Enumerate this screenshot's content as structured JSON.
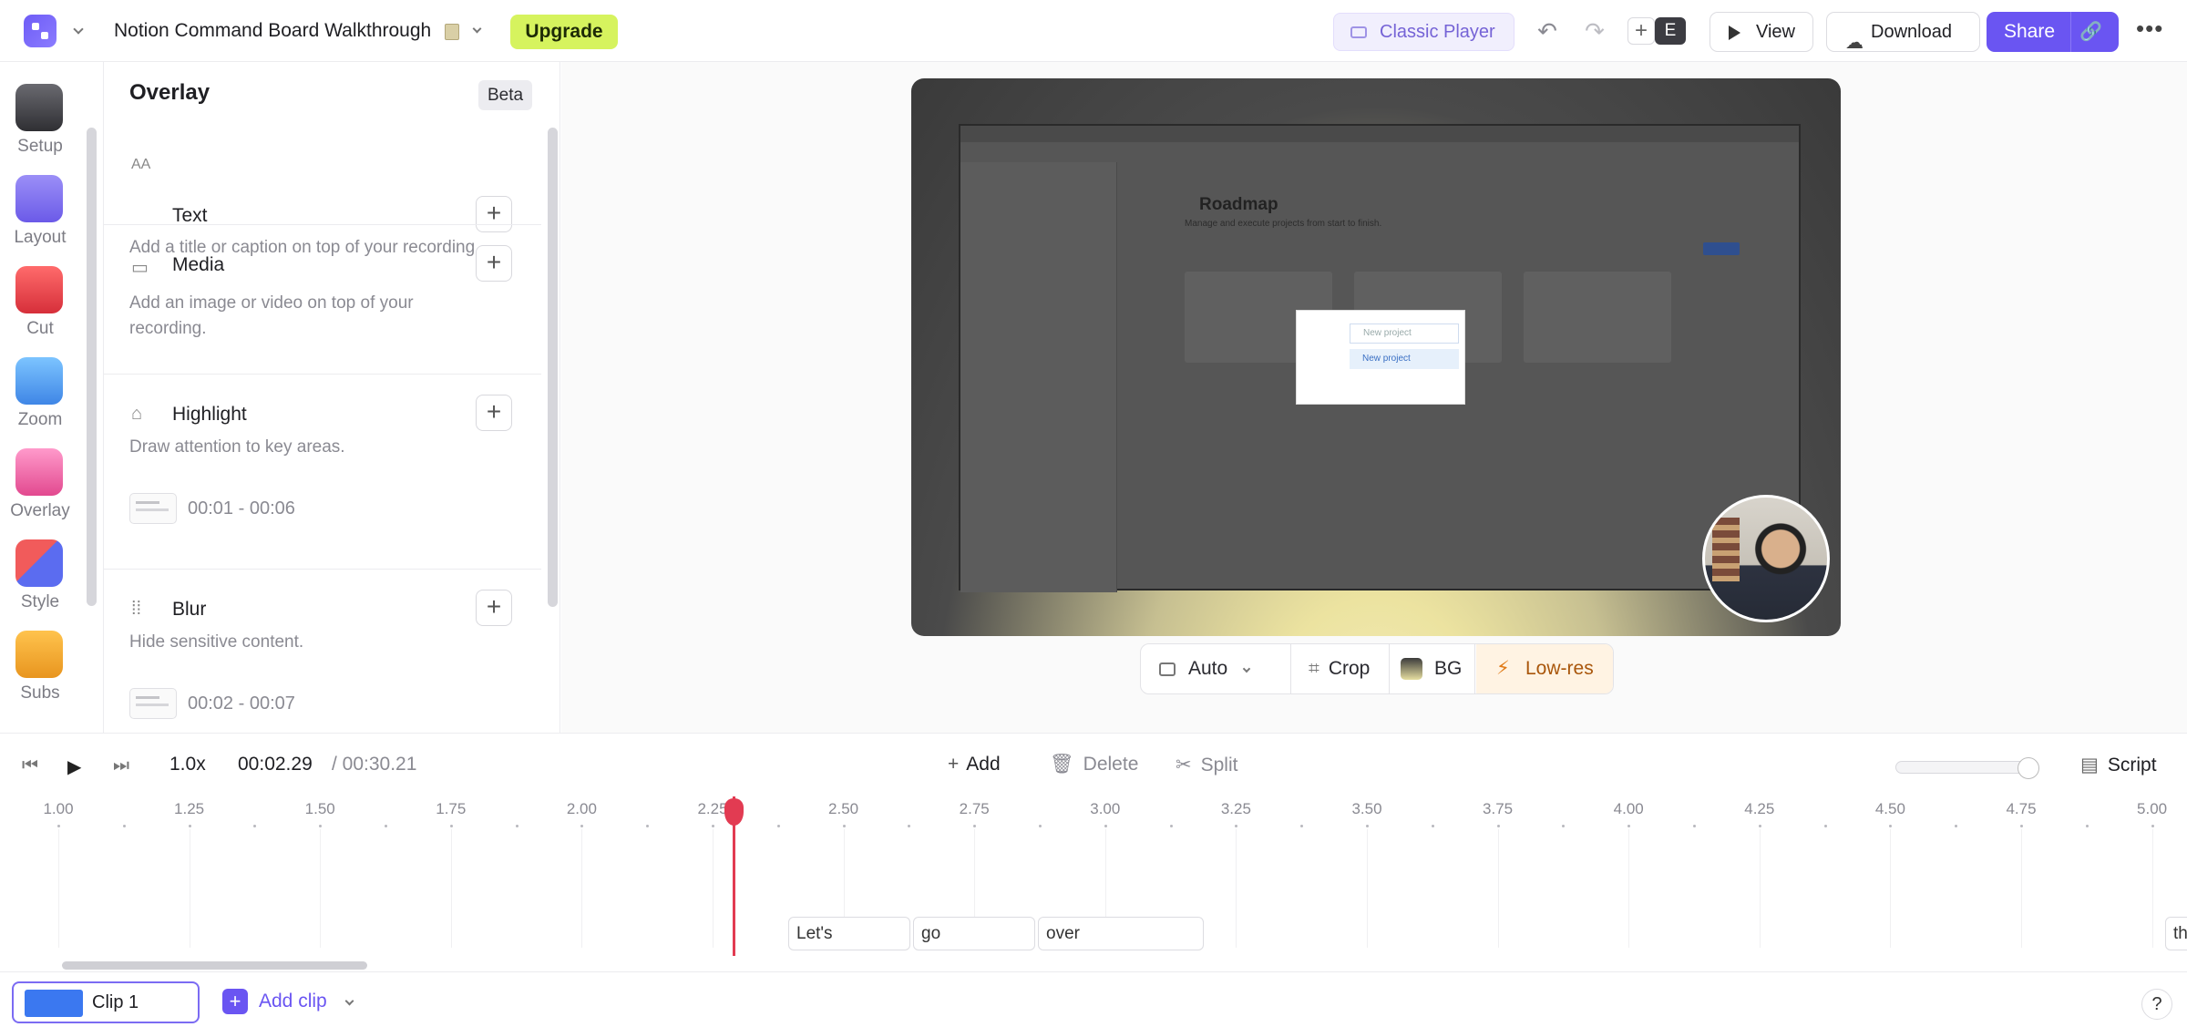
{
  "header": {
    "project_title": "Notion Command Board Walkthrough",
    "upgrade_label": "Upgrade",
    "classic_player_label": "Classic Player",
    "avatar_letter": "E",
    "view_label": "View",
    "download_label": "Download",
    "share_label": "Share",
    "brand_color": "#6a55f2",
    "upgrade_color": "#d6f35e"
  },
  "rail": {
    "tools": [
      {
        "label": "Setup",
        "icon": "clapperboard-icon",
        "color": "#3d3d42"
      },
      {
        "label": "Layout",
        "icon": "layout-icon",
        "color": "#7a6cf0"
      },
      {
        "label": "Cut",
        "icon": "scissors-icon",
        "color": "#e84848"
      },
      {
        "label": "Zoom",
        "icon": "magnifier-icon",
        "color": "#4b9bf0"
      },
      {
        "label": "Overlay",
        "icon": "magic-wand-icon",
        "color": "#f06aa8"
      },
      {
        "label": "Style",
        "icon": "palette-icon",
        "color": "#5b6cf0"
      },
      {
        "label": "Subs",
        "icon": "subtitles-icon",
        "color": "#f0a92e"
      }
    ]
  },
  "panel": {
    "title": "Overlay",
    "badge": "Beta",
    "sections": [
      {
        "name": "Text",
        "icon": "text-icon",
        "desc": "Add a title or caption on top of your recording."
      },
      {
        "name": "Media",
        "icon": "image-icon",
        "desc": "Add an image or video on top of your recording."
      },
      {
        "name": "Highlight",
        "icon": "highlighter-icon",
        "desc": "Draw attention to key areas.",
        "range": "00:01 - 00:06"
      },
      {
        "name": "Blur",
        "icon": "blur-icon",
        "desc": "Hide sensitive content.",
        "range": "00:02 - 00:07"
      }
    ]
  },
  "preview": {
    "screen_title": "Roadmap",
    "screen_subtitle": "Manage and execute projects from start to finish.",
    "popup_item_1": "New project",
    "popup_item_2": "New project",
    "toolbar": {
      "auto_label": "Auto",
      "crop_label": "Crop",
      "bg_label": "BG",
      "lowres_label": "Low-res"
    }
  },
  "timeline": {
    "speed": "1.0x",
    "current_time": "00:02.29",
    "total_time": "/ 00:30.21",
    "add_label": "Add",
    "delete_label": "Delete",
    "split_label": "Split",
    "script_label": "Script",
    "zoom_level": 0.9,
    "playhead_seconds": 2.29,
    "ticks": [
      "1.00",
      "1.25",
      "1.50",
      "1.75",
      "2.00",
      "2.25",
      "2.50",
      "2.75",
      "3.00",
      "3.25",
      "3.50",
      "3.75",
      "4.00",
      "4.25",
      "4.50",
      "4.75",
      "5.00"
    ],
    "words": [
      "Let's",
      "go",
      "over",
      "th"
    ]
  },
  "clips": {
    "clip_label": "Clip 1",
    "add_clip_label": "Add clip",
    "help_label": "?"
  }
}
